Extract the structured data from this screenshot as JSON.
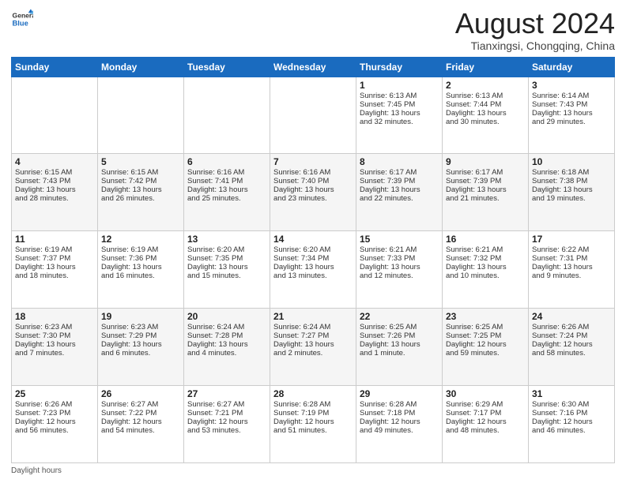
{
  "logo": {
    "general": "General",
    "blue": "Blue"
  },
  "header": {
    "month_year": "August 2024",
    "location": "Tianxingsi, Chongqing, China"
  },
  "weekdays": [
    "Sunday",
    "Monday",
    "Tuesday",
    "Wednesday",
    "Thursday",
    "Friday",
    "Saturday"
  ],
  "weeks": [
    [
      {
        "day": "",
        "info": ""
      },
      {
        "day": "",
        "info": ""
      },
      {
        "day": "",
        "info": ""
      },
      {
        "day": "",
        "info": ""
      },
      {
        "day": "1",
        "info": "Sunrise: 6:13 AM\nSunset: 7:45 PM\nDaylight: 13 hours\nand 32 minutes."
      },
      {
        "day": "2",
        "info": "Sunrise: 6:13 AM\nSunset: 7:44 PM\nDaylight: 13 hours\nand 30 minutes."
      },
      {
        "day": "3",
        "info": "Sunrise: 6:14 AM\nSunset: 7:43 PM\nDaylight: 13 hours\nand 29 minutes."
      }
    ],
    [
      {
        "day": "4",
        "info": "Sunrise: 6:15 AM\nSunset: 7:43 PM\nDaylight: 13 hours\nand 28 minutes."
      },
      {
        "day": "5",
        "info": "Sunrise: 6:15 AM\nSunset: 7:42 PM\nDaylight: 13 hours\nand 26 minutes."
      },
      {
        "day": "6",
        "info": "Sunrise: 6:16 AM\nSunset: 7:41 PM\nDaylight: 13 hours\nand 25 minutes."
      },
      {
        "day": "7",
        "info": "Sunrise: 6:16 AM\nSunset: 7:40 PM\nDaylight: 13 hours\nand 23 minutes."
      },
      {
        "day": "8",
        "info": "Sunrise: 6:17 AM\nSunset: 7:39 PM\nDaylight: 13 hours\nand 22 minutes."
      },
      {
        "day": "9",
        "info": "Sunrise: 6:17 AM\nSunset: 7:39 PM\nDaylight: 13 hours\nand 21 minutes."
      },
      {
        "day": "10",
        "info": "Sunrise: 6:18 AM\nSunset: 7:38 PM\nDaylight: 13 hours\nand 19 minutes."
      }
    ],
    [
      {
        "day": "11",
        "info": "Sunrise: 6:19 AM\nSunset: 7:37 PM\nDaylight: 13 hours\nand 18 minutes."
      },
      {
        "day": "12",
        "info": "Sunrise: 6:19 AM\nSunset: 7:36 PM\nDaylight: 13 hours\nand 16 minutes."
      },
      {
        "day": "13",
        "info": "Sunrise: 6:20 AM\nSunset: 7:35 PM\nDaylight: 13 hours\nand 15 minutes."
      },
      {
        "day": "14",
        "info": "Sunrise: 6:20 AM\nSunset: 7:34 PM\nDaylight: 13 hours\nand 13 minutes."
      },
      {
        "day": "15",
        "info": "Sunrise: 6:21 AM\nSunset: 7:33 PM\nDaylight: 13 hours\nand 12 minutes."
      },
      {
        "day": "16",
        "info": "Sunrise: 6:21 AM\nSunset: 7:32 PM\nDaylight: 13 hours\nand 10 minutes."
      },
      {
        "day": "17",
        "info": "Sunrise: 6:22 AM\nSunset: 7:31 PM\nDaylight: 13 hours\nand 9 minutes."
      }
    ],
    [
      {
        "day": "18",
        "info": "Sunrise: 6:23 AM\nSunset: 7:30 PM\nDaylight: 13 hours\nand 7 minutes."
      },
      {
        "day": "19",
        "info": "Sunrise: 6:23 AM\nSunset: 7:29 PM\nDaylight: 13 hours\nand 6 minutes."
      },
      {
        "day": "20",
        "info": "Sunrise: 6:24 AM\nSunset: 7:28 PM\nDaylight: 13 hours\nand 4 minutes."
      },
      {
        "day": "21",
        "info": "Sunrise: 6:24 AM\nSunset: 7:27 PM\nDaylight: 13 hours\nand 2 minutes."
      },
      {
        "day": "22",
        "info": "Sunrise: 6:25 AM\nSunset: 7:26 PM\nDaylight: 13 hours\nand 1 minute."
      },
      {
        "day": "23",
        "info": "Sunrise: 6:25 AM\nSunset: 7:25 PM\nDaylight: 12 hours\nand 59 minutes."
      },
      {
        "day": "24",
        "info": "Sunrise: 6:26 AM\nSunset: 7:24 PM\nDaylight: 12 hours\nand 58 minutes."
      }
    ],
    [
      {
        "day": "25",
        "info": "Sunrise: 6:26 AM\nSunset: 7:23 PM\nDaylight: 12 hours\nand 56 minutes."
      },
      {
        "day": "26",
        "info": "Sunrise: 6:27 AM\nSunset: 7:22 PM\nDaylight: 12 hours\nand 54 minutes."
      },
      {
        "day": "27",
        "info": "Sunrise: 6:27 AM\nSunset: 7:21 PM\nDaylight: 12 hours\nand 53 minutes."
      },
      {
        "day": "28",
        "info": "Sunrise: 6:28 AM\nSunset: 7:19 PM\nDaylight: 12 hours\nand 51 minutes."
      },
      {
        "day": "29",
        "info": "Sunrise: 6:28 AM\nSunset: 7:18 PM\nDaylight: 12 hours\nand 49 minutes."
      },
      {
        "day": "30",
        "info": "Sunrise: 6:29 AM\nSunset: 7:17 PM\nDaylight: 12 hours\nand 48 minutes."
      },
      {
        "day": "31",
        "info": "Sunrise: 6:30 AM\nSunset: 7:16 PM\nDaylight: 12 hours\nand 46 minutes."
      }
    ]
  ],
  "footer": {
    "note": "Daylight hours"
  }
}
